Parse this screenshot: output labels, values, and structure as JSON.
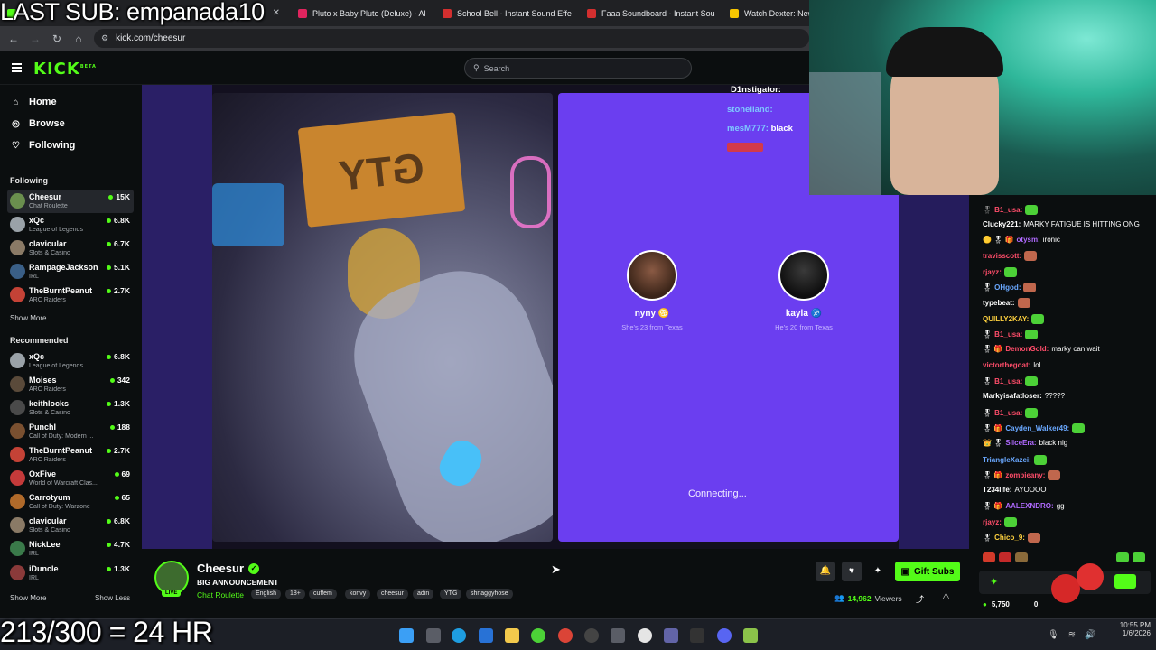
{
  "browser": {
    "tabs": [
      {
        "title": "",
        "color": "#53fc18"
      },
      {
        "title": "Pluto x Baby Pluto (Deluxe) - Al",
        "color": "#e0245e"
      },
      {
        "title": "School Bell - Instant Sound Effe",
        "color": "#d32f2f"
      },
      {
        "title": "Faaa Soundboard - Instant Sou",
        "color": "#d32f2f"
      },
      {
        "title": "Watch Dexter: New B",
        "color": "#f7c600"
      }
    ],
    "url": "kick.com/cheesur"
  },
  "kick": {
    "logo": "KICK",
    "logo_sup": "BETA",
    "search_placeholder": "Search"
  },
  "sidebar": {
    "nav": [
      {
        "label": "Home",
        "icon": "home-icon",
        "glyph": "⌂"
      },
      {
        "label": "Browse",
        "icon": "browse-icon",
        "glyph": "◎"
      },
      {
        "label": "Following",
        "icon": "heart-icon",
        "glyph": "♡"
      }
    ],
    "following_title": "Following",
    "following": [
      {
        "name": "Cheesur",
        "category": "Chat Roulette",
        "viewers": "15K",
        "color": "#6a8f4e"
      },
      {
        "name": "xQc",
        "category": "League of Legends",
        "viewers": "6.8K",
        "color": "#9aa2a8"
      },
      {
        "name": "clavicular",
        "category": "Slots & Casino",
        "viewers": "6.7K",
        "color": "#8a7a66"
      },
      {
        "name": "RampageJackson",
        "category": "IRL",
        "viewers": "5.1K",
        "color": "#3a5f87"
      },
      {
        "name": "TheBurntPeanut",
        "category": "ARC Raiders",
        "viewers": "2.7K",
        "color": "#c44236"
      }
    ],
    "show_more_1": "Show More",
    "recommended_title": "Recommended",
    "recommended": [
      {
        "name": "xQc",
        "category": "League of Legends",
        "viewers": "6.8K",
        "color": "#9aa2a8"
      },
      {
        "name": "Moises",
        "category": "ARC Raiders",
        "viewers": "342",
        "color": "#5a4a3a"
      },
      {
        "name": "keithlocks",
        "category": "Slots & Casino",
        "viewers": "1.3K",
        "color": "#4a4a4a"
      },
      {
        "name": "PunchI",
        "category": "Call of Duty: Modern ...",
        "viewers": "188",
        "color": "#7a5030"
      },
      {
        "name": "TheBurntPeanut",
        "category": "ARC Raiders",
        "viewers": "2.7K",
        "color": "#c44236"
      },
      {
        "name": "OxFive",
        "category": "World of Warcraft Clas...",
        "viewers": "69",
        "color": "#c43a3a"
      },
      {
        "name": "Carrotyum",
        "category": "Call of Duty: Warzone",
        "viewers": "65",
        "color": "#b06a2a"
      },
      {
        "name": "clavicular",
        "category": "Slots & Casino",
        "viewers": "6.8K",
        "color": "#8a7a66"
      },
      {
        "name": "NickLee",
        "category": "IRL",
        "viewers": "4.7K",
        "color": "#3a7a4a"
      },
      {
        "name": "iDuncle",
        "category": "IRL",
        "viewers": "1.3K",
        "color": "#8a3a3a"
      }
    ],
    "show_more_2": "Show More",
    "show_less": "Show Less"
  },
  "stream": {
    "left_cam_sign": "GTY",
    "people": [
      {
        "name": "nyny",
        "emoji": "♋",
        "desc": "She's 23 from Texas"
      },
      {
        "name": "kayla",
        "emoji": "♐",
        "desc": "He's 20 from Texas"
      }
    ],
    "status": "Connecting...",
    "overlay_chat": [
      {
        "user": "D1nstigator:",
        "text": "",
        "color": "#ffffff"
      },
      {
        "user": "stoneiland:",
        "text": "",
        "color": "#7ec8ff"
      },
      {
        "user": "mesM777:",
        "text": "black",
        "color": "#7ec8ff"
      },
      {
        "user": "",
        "text": "",
        "color": "#e04040"
      }
    ]
  },
  "chat": {
    "messages": [
      {
        "user": "",
        "text": "",
        "ucolor": "#cccccc",
        "badges": ""
      },
      {
        "user": "B1_usa:",
        "text": "",
        "ucolor": "#ff4d6a",
        "badges": "",
        "emote": "#4cd137"
      },
      {
        "user": "Clucky221:",
        "text": "MARKY FATIGUE IS HITTING ONG",
        "ucolor": "#ffffff",
        "badges": ""
      },
      {
        "user": "otysm:",
        "text": "ironic",
        "ucolor": "#b06aff",
        "badges": "🟡 🎖 🎁"
      },
      {
        "user": "travisscott:",
        "text": "",
        "ucolor": "#ff4d6a",
        "badges": "",
        "emote": "#c0674d"
      },
      {
        "user": "rjayz:",
        "text": "",
        "ucolor": "#ff4d6a",
        "badges": "",
        "emote": "#4cd137"
      },
      {
        "user": "OHgod:",
        "text": "",
        "ucolor": "#6aa8ff",
        "badges": "🎖",
        "emote": "#c0674d"
      },
      {
        "user": "typebeat:",
        "text": "",
        "ucolor": "#ffffff",
        "badges": "",
        "emote": "#c0674d"
      },
      {
        "user": "QUILLY2KAY:",
        "text": "",
        "ucolor": "#ffd23f",
        "badges": "",
        "emote": "#4cd137"
      },
      {
        "user": "B1_usa:",
        "text": "",
        "ucolor": "#ff4d6a",
        "badges": "🎖",
        "emote": "#4cd137"
      },
      {
        "user": "DemonGold:",
        "text": "marky can wait",
        "ucolor": "#ff4d6a",
        "badges": "🎖 🎁"
      },
      {
        "user": "victorthegoat:",
        "text": "lol",
        "ucolor": "#ff4d6a",
        "badges": ""
      },
      {
        "user": "B1_usa:",
        "text": "",
        "ucolor": "#ff4d6a",
        "badges": "🎖",
        "emote": "#4cd137"
      },
      {
        "user": "Markyisafatloser:",
        "text": "?????",
        "ucolor": "#ffffff",
        "badges": ""
      },
      {
        "user": "B1_usa:",
        "text": "",
        "ucolor": "#ff4d6a",
        "badges": "🎖",
        "emote": "#4cd137"
      },
      {
        "user": "Cayden_Walker49:",
        "text": "",
        "ucolor": "#6aa8ff",
        "badges": "🎖 🎁",
        "emote": "#4cd137"
      },
      {
        "user": "SliceEra:",
        "text": "black nig",
        "ucolor": "#b06aff",
        "badges": "👑 🎖"
      },
      {
        "user": "TriangleXazei:",
        "text": "",
        "ucolor": "#6aa8ff",
        "badges": "",
        "emote": "#4cd137"
      },
      {
        "user": "zombieany:",
        "text": "",
        "ucolor": "#ff4d6a",
        "badges": "🎖 🎁",
        "emote": "#c0674d"
      },
      {
        "user": "T234life:",
        "text": "AYOOOO",
        "ucolor": "#ffffff",
        "badges": ""
      },
      {
        "user": "AALEXNDRO:",
        "text": "gg",
        "ucolor": "#b06aff",
        "badges": "🎖 🎁"
      },
      {
        "user": "rjayz:",
        "text": "",
        "ucolor": "#ff4d6a",
        "badges": "",
        "emote": "#4cd137"
      },
      {
        "user": "Chico_9:",
        "text": "",
        "ucolor": "#ffd23f",
        "badges": "🎖",
        "emote": "#c0674d"
      }
    ],
    "balance": "5,750",
    "balance_zero": "0"
  },
  "channel": {
    "name": "Cheesur",
    "title": "BIG ANNOUNCEMENT",
    "category": "Chat Roulette",
    "live": "LIVE",
    "tags": [
      "English",
      "18+",
      "cuffem",
      "konvy",
      "cheesur",
      "adin",
      "YTG",
      "shnaggyhose"
    ],
    "gift_label": "Gift Subs",
    "viewers": "14,962",
    "viewers_label": "Viewers"
  },
  "overlay": {
    "last_sub": "LAST SUB: empanada10",
    "sub_goal": "213/300 = 24 HR"
  },
  "taskbar": {
    "time": "10:55 PM",
    "date": "1/6/2026"
  },
  "colors": {
    "kick_green": "#53fc18",
    "roulette_purple": "#6b3ef0"
  }
}
